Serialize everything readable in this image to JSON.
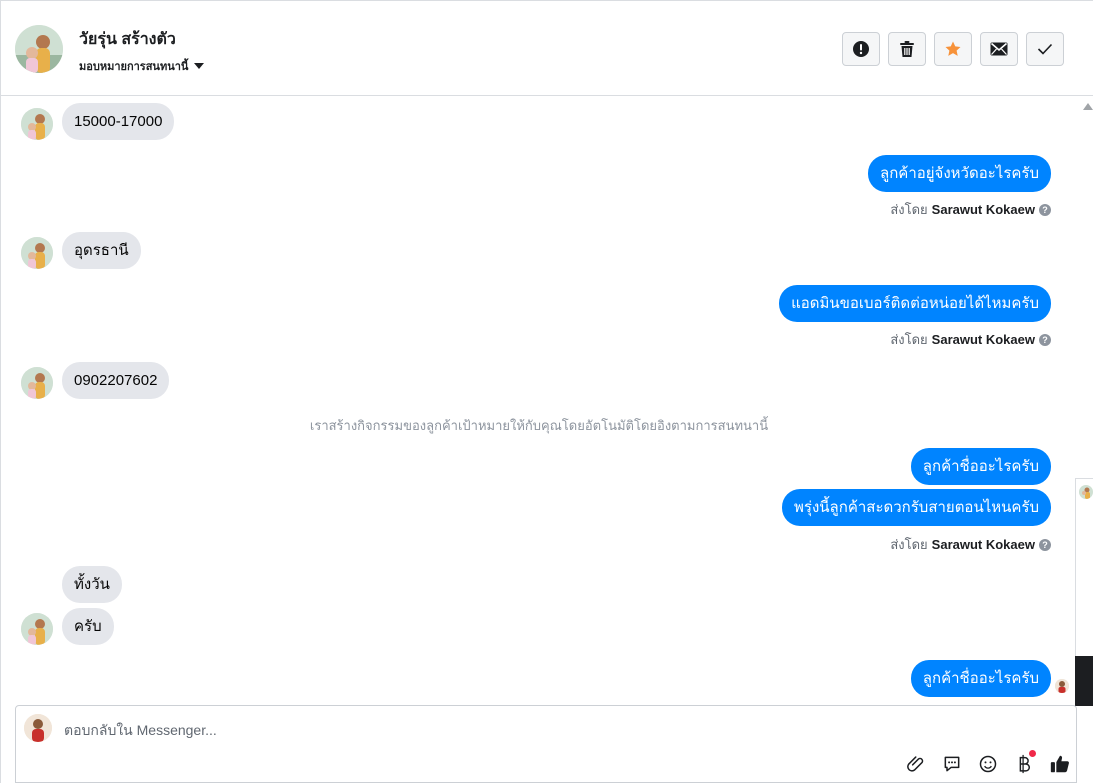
{
  "header": {
    "contact_name": "วัยรุ่น สร้างตัว",
    "assign_label": "มอบหมายการสนทนานี้",
    "actions": [
      {
        "name": "spam-button",
        "icon": "exclamation-icon"
      },
      {
        "name": "delete-button",
        "icon": "trash-icon"
      },
      {
        "name": "star-button",
        "icon": "star-icon"
      },
      {
        "name": "mark-unread-button",
        "icon": "envelope-icon"
      },
      {
        "name": "mark-done-button",
        "icon": "checkmark-icon"
      }
    ]
  },
  "messages": {
    "m1": "15000-17000",
    "m2": "ลูกค้าอยู่จังหวัดอะไรครับ",
    "m3": "อุดรธานี",
    "m4": "แอดมินขอเบอร์ติดต่อหน่อยได้ไหมครับ",
    "m5": "0902207602",
    "m6": "ลูกค้าชื่ออะไรครับ",
    "m7": "พรุ่งนี้ลูกค้าสะดวกรับสายตอนไหนครับ",
    "m8": "ทั้งวัน",
    "m9": "ครับ",
    "m10": "ลูกค้าชื่ออะไรครับ"
  },
  "sent_by": {
    "prefix": "ส่งโดย",
    "name": "Sarawut Kokaew",
    "help": "?"
  },
  "system_note": "เราสร้างกิจกรรมของลูกค้าเป้าหมายให้กับคุณโดยอัตโนมัติโดยอิงตามการสนทนานี้",
  "composer": {
    "placeholder": "ตอบกลับใน Messenger...",
    "tools": [
      "paperclip-icon",
      "saved-reply-icon",
      "emoji-icon",
      "baht-icon",
      "thumbs-up-icon"
    ]
  },
  "colors": {
    "outgoing": "#0084ff",
    "incoming": "#e4e6eb",
    "star": "#f7923a",
    "notification_dot": "#f02849"
  }
}
